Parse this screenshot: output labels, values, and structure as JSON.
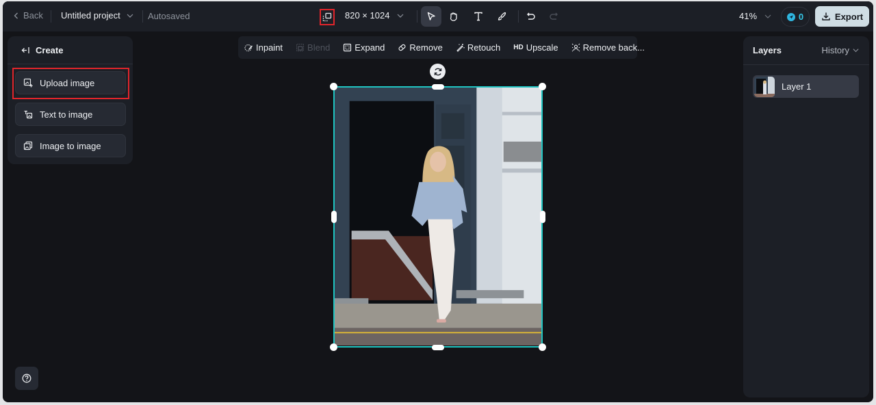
{
  "topbar": {
    "back_label": "Back",
    "project_title": "Untitled project",
    "save_status": "Autosaved",
    "canvas_size": "820 × 1024",
    "zoom": "41%",
    "credits": "0",
    "export_label": "Export",
    "tools": [
      {
        "name": "select",
        "icon": "cursor-arrow-icon",
        "active": true
      },
      {
        "name": "pan",
        "icon": "hand-icon",
        "active": false
      },
      {
        "name": "text",
        "icon": "text-icon",
        "active": false
      },
      {
        "name": "brush",
        "icon": "brush-icon",
        "active": false
      },
      {
        "name": "undo",
        "icon": "undo-icon",
        "active": false
      },
      {
        "name": "redo",
        "icon": "redo-icon",
        "active": false,
        "disabled": true
      }
    ]
  },
  "left_panel": {
    "header": "Create",
    "options": [
      {
        "label": "Upload image",
        "icon": "upload-image-icon",
        "highlighted": true
      },
      {
        "label": "Text to image",
        "icon": "text-to-image-icon"
      },
      {
        "label": "Image to image",
        "icon": "image-to-image-icon"
      }
    ]
  },
  "edit_toolbar": {
    "items": [
      {
        "label": "Inpaint",
        "icon": "inpaint-icon",
        "disabled": false
      },
      {
        "label": "Blend",
        "icon": "blend-icon",
        "disabled": true
      },
      {
        "label": "Expand",
        "icon": "expand-icon",
        "disabled": false
      },
      {
        "label": "Remove",
        "icon": "eraser-icon",
        "disabled": false
      },
      {
        "label": "Retouch",
        "icon": "magic-wand-icon",
        "disabled": false
      },
      {
        "label": "Upscale",
        "icon": "hd-icon",
        "badge": "HD",
        "disabled": false
      },
      {
        "label": "Remove back...",
        "icon": "remove-background-icon",
        "disabled": false
      }
    ]
  },
  "right_panel": {
    "title": "Layers",
    "history_label": "History",
    "layers": [
      {
        "label": "Layer 1"
      }
    ]
  },
  "colors": {
    "accent_selection": "#1fc5c2",
    "highlight_box": "#e1252b",
    "export_bg": "#cfdde4",
    "credits": "#36c8e8"
  }
}
